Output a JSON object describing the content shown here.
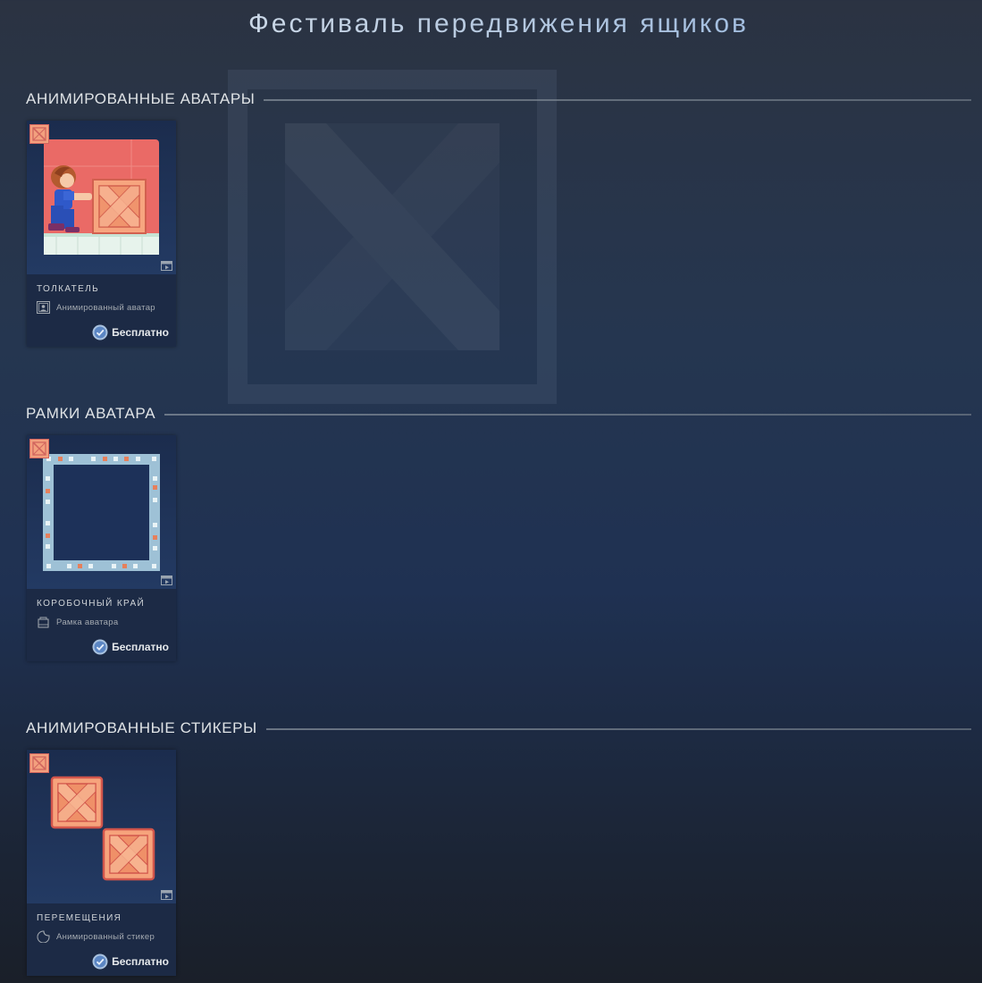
{
  "page_title": "Фестиваль передвижения ящиков",
  "colors": {
    "accent_title": "#8fb3df",
    "crate_fill": "#f3a07e",
    "crate_border": "#d1655e",
    "card_bg": "#1c2a45"
  },
  "sections": [
    {
      "title": "АНИМИРОВАННЫЕ АВАТАРЫ",
      "item": {
        "name": "ТОЛКАТЕЛЬ",
        "type": "Анимированный аватар",
        "type_icon": "avatar-icon",
        "price": "Бесплатно",
        "animated_icon": "film-icon"
      }
    },
    {
      "title": "РАМКИ АВАТАРА",
      "item": {
        "name": "КОРОБОЧНЫЙ КРАЙ",
        "type": "Рамка аватара",
        "type_icon": "frame-icon",
        "price": "Бесплатно",
        "animated_icon": "film-icon"
      }
    },
    {
      "title": "АНИМИРОВАННЫЕ СТИКЕРЫ",
      "item": {
        "name": "ПЕРЕМЕЩЕНИЯ",
        "type": "Анимированный стикер",
        "type_icon": "sticker-icon",
        "price": "Бесплатно",
        "animated_icon": "film-icon"
      }
    }
  ]
}
